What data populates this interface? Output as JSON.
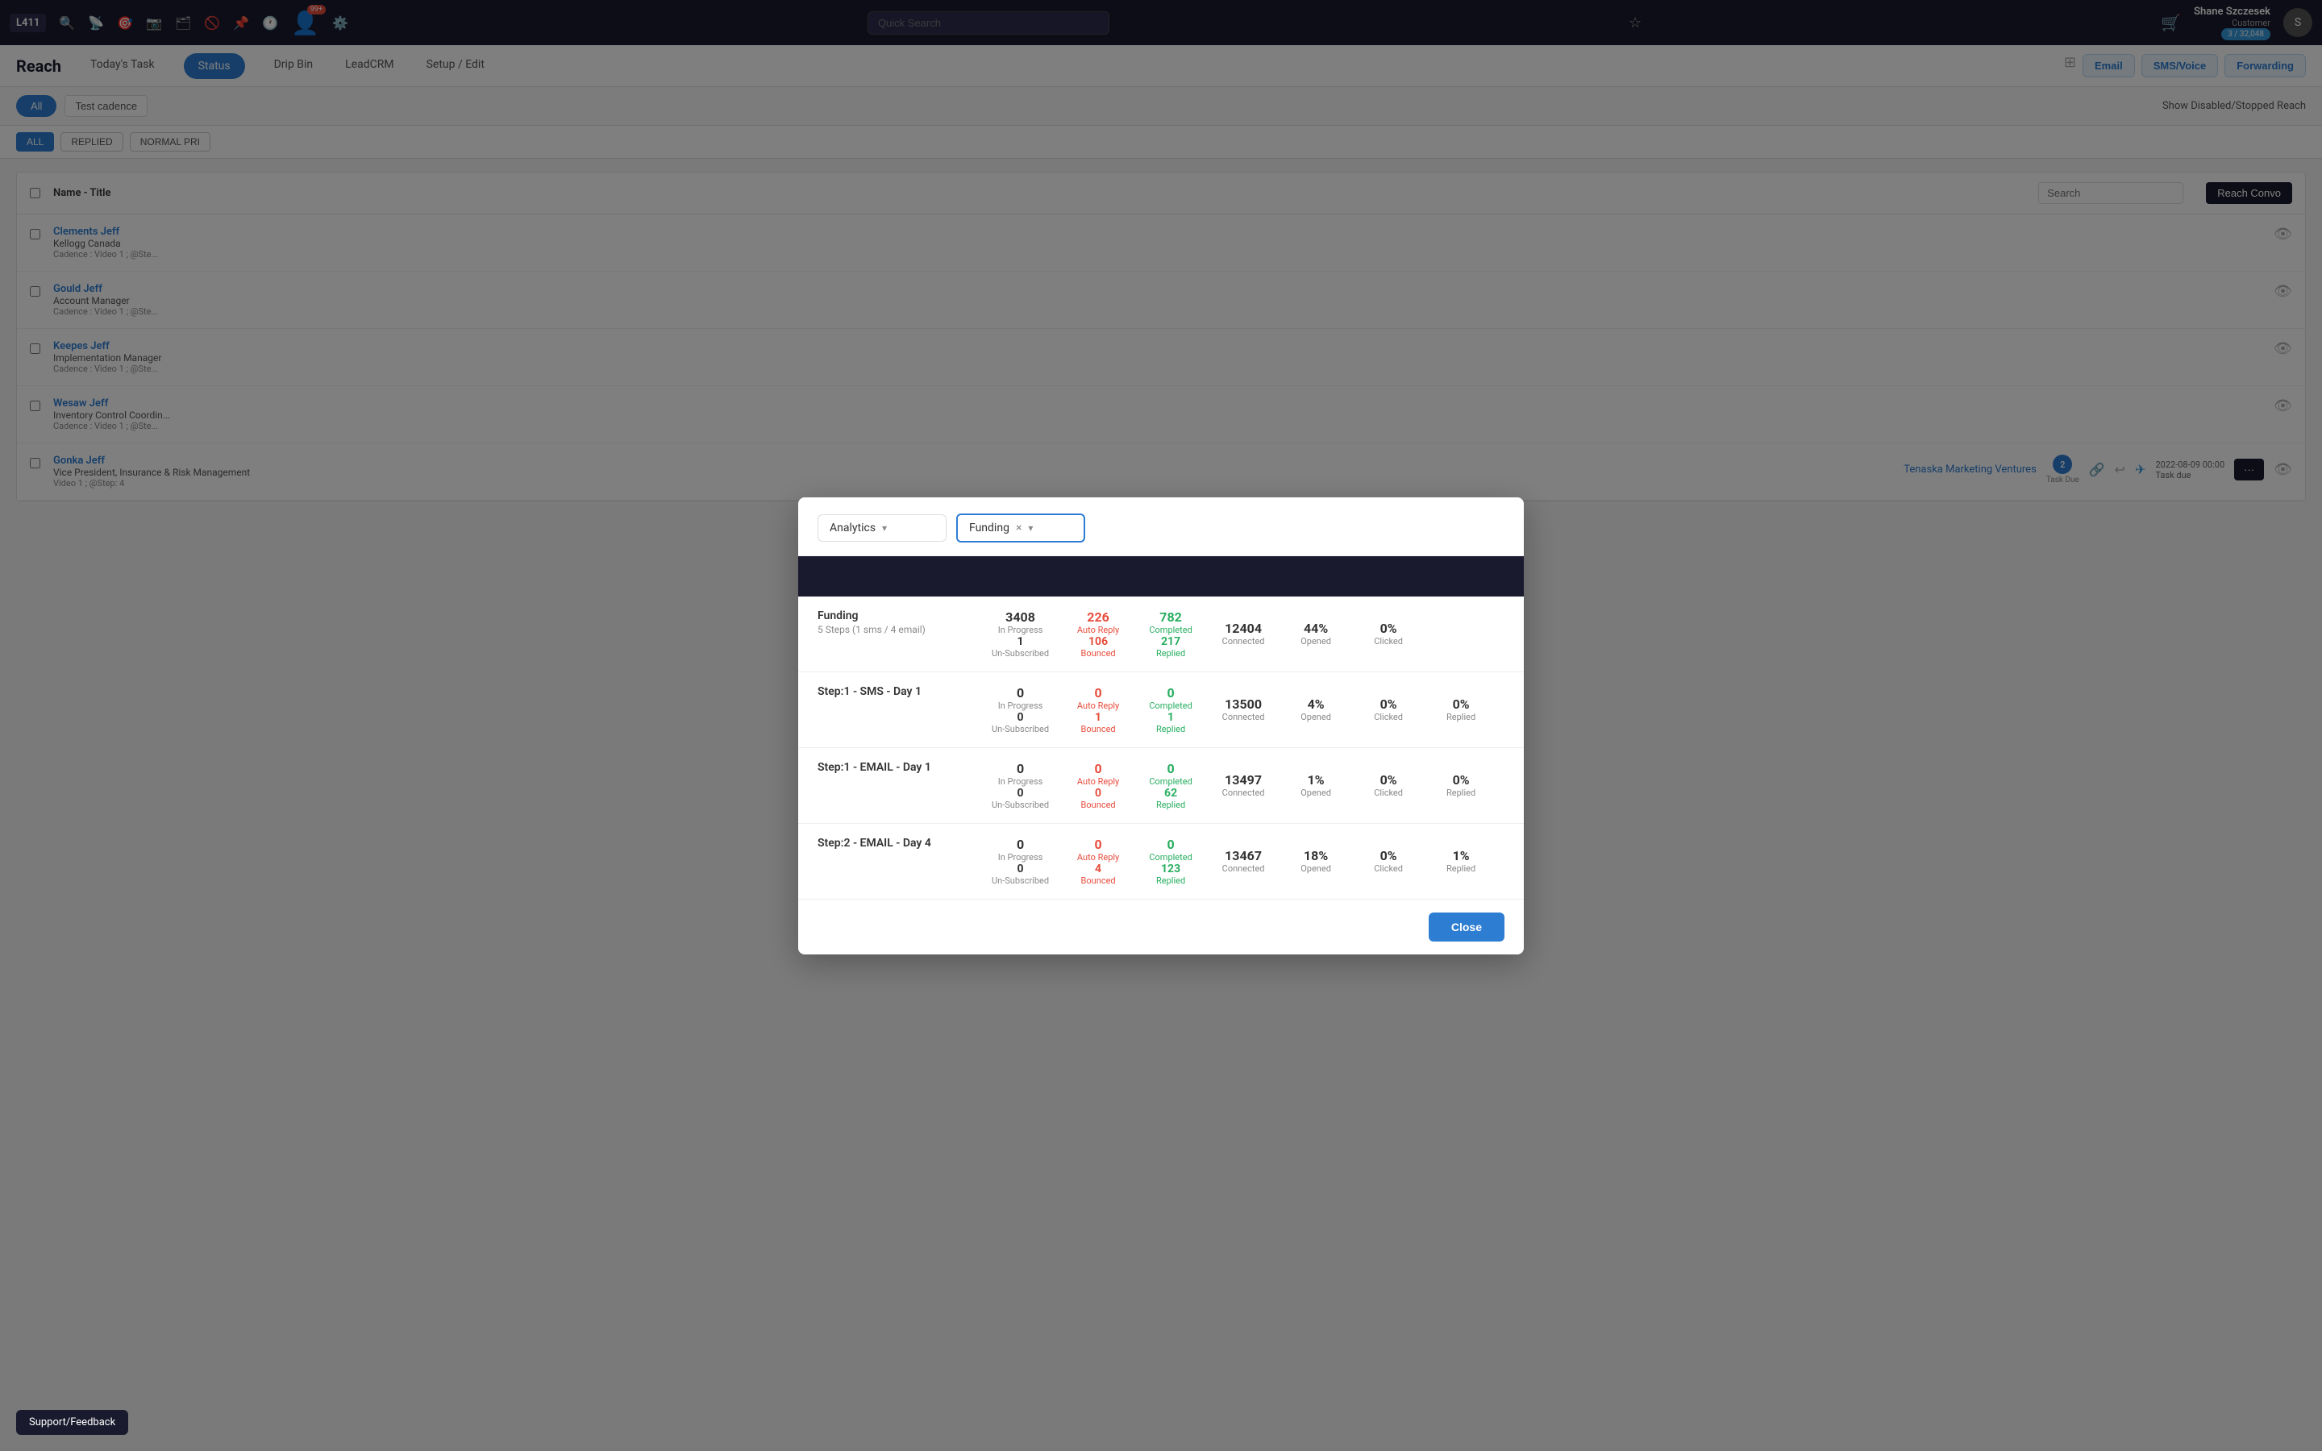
{
  "app": {
    "label": "L411",
    "badge": "99+",
    "quick_search_placeholder": "Quick Search"
  },
  "user": {
    "name": "Shane Szczesek",
    "role": "Customer",
    "usage": "3 / 32,048"
  },
  "sub_nav": {
    "title": "Reach",
    "tabs": [
      {
        "label": "Today's Task",
        "active": false
      },
      {
        "label": "Status",
        "active": true
      },
      {
        "label": "Drip Bin",
        "active": false
      },
      {
        "label": "LeadCRM",
        "active": false
      },
      {
        "label": "Setup / Edit",
        "active": false
      }
    ],
    "right_buttons": [
      "Email",
      "SMS/Voice",
      "Forwarding"
    ]
  },
  "filter_bar": {
    "all_label": "All",
    "test_cadence_label": "Test cadence",
    "show_disabled_label": "Show Disabled/Stopped Reach"
  },
  "tag_pills": [
    "ALL",
    "REPLIED",
    "NORMAL PRI"
  ],
  "table": {
    "header": {
      "name_col": "Name - Title",
      "search_placeholder": "Search",
      "reach_convo": "Reach Convo"
    },
    "rows": [
      {
        "name": "Clements Jeff",
        "title": "Kellogg Canada",
        "cadence": "Cadence : Video 1 ; @Ste..."
      },
      {
        "name": "Gould Jeff",
        "title": "Account Manager",
        "cadence": "Cadence : Video 1 ; @Ste..."
      },
      {
        "name": "Keepes Jeff",
        "title": "Implementation Manager",
        "cadence": "Cadence : Video 1 ; @Ste..."
      },
      {
        "name": "Wesaw Jeff",
        "title": "Inventory Control Coordin...",
        "cadence": "Cadence : Video 1 ; @Ste..."
      },
      {
        "name": "Gonka Jeff",
        "title": "Vice President, Insurance & Risk Management",
        "company": "Tenaska Marketing Ventures",
        "cadence": "Video 1 ; @Step: 4",
        "task_count": "2",
        "task_label": "Task Due",
        "date": "2022-08-09 00:00",
        "date_label": "Task due"
      }
    ]
  },
  "modal": {
    "analytics_label": "Analytics",
    "analytics_chevron": "▾",
    "funding_label": "Funding",
    "funding_clear": "×",
    "funding_chevron": "▾",
    "banner_color": "#1a1a2e",
    "rows": [
      {
        "label": "Funding",
        "sub_label": "5 Steps (1 sms / 4 email)",
        "in_progress": "3408",
        "in_progress_label": "In Progress",
        "unsub": "1",
        "unsub_label": "Un-Subscribed",
        "auto_reply": "226",
        "auto_reply_label": "Auto Reply",
        "bounced": "106",
        "bounced_label": "Bounced",
        "completed": "782",
        "completed_label": "Completed",
        "replied": "217",
        "replied_label": "Replied",
        "connected": "12404",
        "connected_label": "Connected",
        "opened_pct": "44%",
        "opened_label": "Opened",
        "clicked_pct": "0%",
        "clicked_label": "Clicked"
      },
      {
        "label": "Step:1 - SMS - Day 1",
        "sub_label": "",
        "in_progress": "0",
        "in_progress_label": "In Progress",
        "unsub": "0",
        "unsub_label": "Un-Subscribed",
        "auto_reply": "0",
        "auto_reply_label": "Auto Reply",
        "bounced": "1",
        "bounced_label": "Bounced",
        "completed": "0",
        "completed_label": "Completed",
        "replied": "1",
        "replied_label": "Replied",
        "connected": "13500",
        "connected_label": "Connected",
        "opened_pct": "4%",
        "opened_label": "Opened",
        "clicked_pct": "0%",
        "clicked_label": "Clicked",
        "replied_pct": "0%",
        "replied_pct_label": "Replied"
      },
      {
        "label": "Step:1 - EMAIL - Day 1",
        "sub_label": "",
        "in_progress": "0",
        "in_progress_label": "In Progress",
        "unsub": "0",
        "unsub_label": "Un-Subscribed",
        "auto_reply": "0",
        "auto_reply_label": "Auto Reply",
        "bounced": "0",
        "bounced_label": "Bounced",
        "completed": "0",
        "completed_label": "Completed",
        "replied": "62",
        "replied_label": "Replied",
        "connected": "13497",
        "connected_label": "Connected",
        "opened_pct": "1%",
        "opened_label": "Opened",
        "clicked_pct": "0%",
        "clicked_label": "Clicked",
        "replied_pct": "0%",
        "replied_pct_label": "Replied"
      },
      {
        "label": "Step:2 - EMAIL - Day 4",
        "sub_label": "",
        "in_progress": "0",
        "in_progress_label": "In Progress",
        "unsub": "0",
        "unsub_label": "Un-Subscribed",
        "auto_reply": "0",
        "auto_reply_label": "Auto Reply",
        "bounced": "4",
        "bounced_label": "Bounced",
        "completed": "0",
        "completed_label": "Completed",
        "replied": "123",
        "replied_label": "Replied",
        "connected": "13467",
        "connected_label": "Connected",
        "opened_pct": "18%",
        "opened_label": "Opened",
        "clicked_pct": "0%",
        "clicked_label": "Clicked",
        "replied_pct": "1%",
        "replied_pct_label": "Replied"
      }
    ],
    "close_label": "Close"
  },
  "support": {
    "label": "Support/Feedback"
  }
}
